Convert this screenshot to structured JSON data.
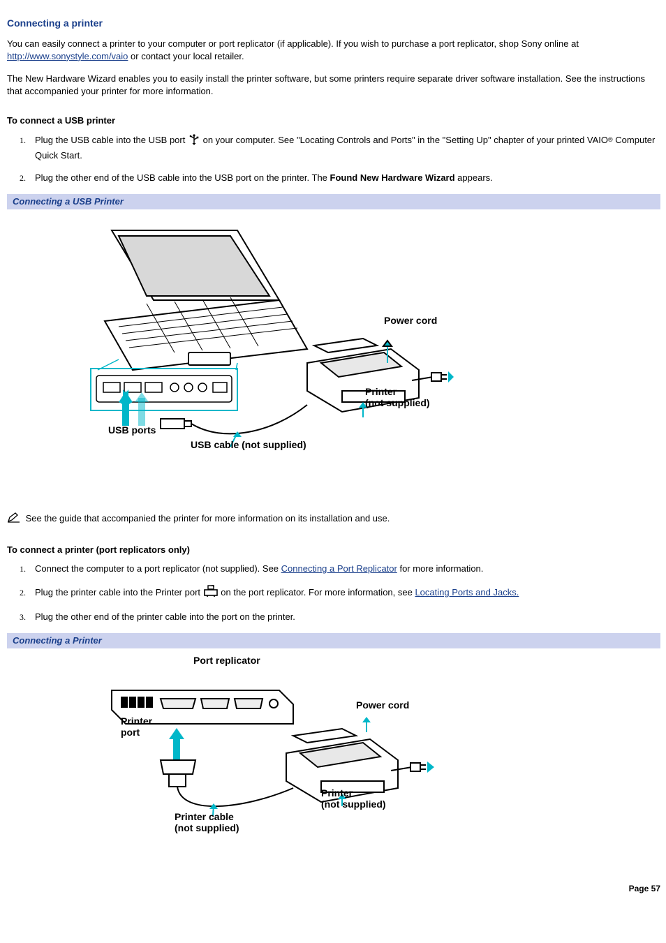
{
  "title": "Connecting a printer",
  "intro1_a": "You can easily connect a printer to your computer or port replicator (if applicable). If you wish to purchase a port replicator, shop Sony online at ",
  "intro1_link": "http://www.sonystyle.com/vaio",
  "intro1_b": " or contact your local retailer.",
  "intro2": "The New Hardware Wizard enables you to easily install the printer software, but some printers require separate driver software installation. See the instructions that accompanied your printer for more information.",
  "subhead_usb": "To connect a USB printer",
  "usb_step1_a": "Plug the USB cable into the USB port ",
  "usb_step1_b": " on your computer. See \"Locating Controls and Ports\" in the \"Setting Up\" chapter of your printed VAIO",
  "usb_step1_c": " Computer Quick Start.",
  "usb_step2_a": "Plug the other end of the USB cable into the USB port on the printer. The ",
  "usb_step2_bold": "Found New Hardware Wizard",
  "usb_step2_b": " appears.",
  "caption_usb": "Connecting a USB Printer",
  "fig1": {
    "power_cord": "Power cord",
    "printer": "Printer",
    "not_supplied": "(not supplied)",
    "usb_ports": "USB ports",
    "usb_cable": "USB cable (not supplied)"
  },
  "note_usb": "See the guide that accompanied the printer for more information on its installation and use.",
  "subhead_port": "To connect a printer (port replicators only)",
  "port_step1_a": "Connect the computer to a port replicator (not supplied). See ",
  "port_step1_link": "Connecting a Port Replicator",
  "port_step1_b": " for more information.",
  "port_step2_a": "Plug the printer cable into the Printer port ",
  "port_step2_b": " on the port replicator. For more information, see ",
  "port_step2_link": "Locating Ports and Jacks.",
  "port_step3": "Plug the other end of the printer cable into the port on the printer.",
  "caption_port": "Connecting a Printer",
  "fig2": {
    "port_replicator": "Port replicator",
    "printer_port": "Printer",
    "printer_port2": "port",
    "power_cord": "Power cord",
    "printer": "Printer",
    "not_supplied": "(not supplied)",
    "printer_cable": "Printer cable",
    "printer_cable2": "(not supplied)"
  },
  "page_footer": "Page 57"
}
